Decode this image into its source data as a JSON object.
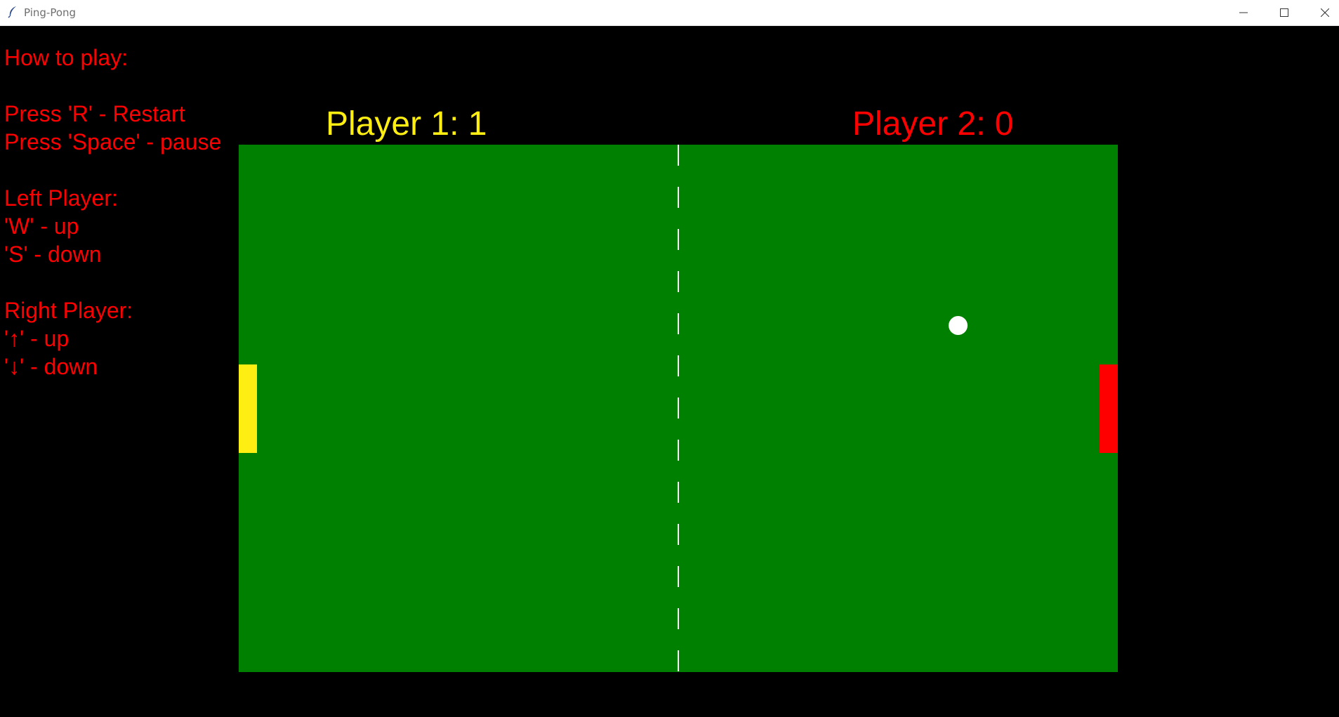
{
  "window": {
    "title": "Ping-Pong",
    "icon": "feather-icon",
    "controls": [
      "minimize-icon",
      "maximize-icon",
      "close-icon"
    ]
  },
  "help": {
    "heading": "How to play:",
    "restart": "Press 'R' - Restart",
    "pause": "Press 'Space' - pause",
    "left_title": "Left Player:",
    "left_up": "'W' - up",
    "left_down": "'S' - down",
    "right_title": "Right Player:",
    "right_up": "'↑' - up",
    "right_down": "'↓' - down"
  },
  "scores": {
    "player1": "Player 1: 1",
    "player2": "Player 2: 0"
  },
  "colors": {
    "background": "#000000",
    "field": "#008000",
    "help_text": "#ff0000",
    "player1": "#ffee12",
    "player2": "#ff0000",
    "ball": "#ffffff",
    "net": "#ffffff"
  }
}
